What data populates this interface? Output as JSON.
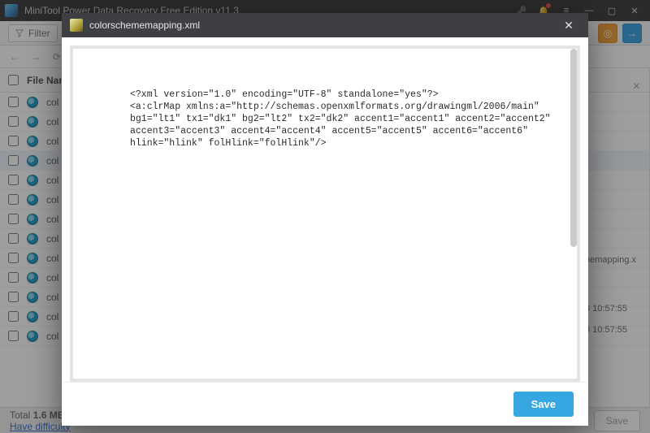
{
  "window": {
    "title": "MiniTool Power Data Recovery Free Edition v11.3"
  },
  "toolbar": {
    "filter_label": "Filter"
  },
  "list": {
    "header_name": "File Name",
    "rows": [
      "colorschememapping.xml",
      "colorschememapping.xml",
      "colorschememapping.xml",
      "colorschememapping.xml",
      "colorschememapping.xml",
      "colorschememapping.xml",
      "colorschememapping.xml",
      "colorschememapping.xml",
      "colorschememapping.xml",
      "colorschememapping.xml",
      "colorschememapping.xml",
      "colorschememapping.xml",
      "colorschememapping.xml"
    ],
    "selected_index": 3
  },
  "right_panel": {
    "filename_fragment": "nemapping.x",
    "time1": "3 10:57:55",
    "time2": "3 10:57:55"
  },
  "footer": {
    "total_prefix": "Total ",
    "total_bold": "1.6 MB",
    "total_suffix": " in",
    "difficulty_link": "Have difficulty",
    "save_label": "Save"
  },
  "modal": {
    "title": "colorschememapping.xml",
    "content": "<?xml version=\"1.0\" encoding=\"UTF-8\" standalone=\"yes\"?>\n<a:clrMap xmlns:a=\"http://schemas.openxmlformats.org/drawingml/2006/main\" bg1=\"lt1\" tx1=\"dk1\" bg2=\"lt2\" tx2=\"dk2\" accent1=\"accent1\" accent2=\"accent2\" accent3=\"accent3\" accent4=\"accent4\" accent5=\"accent5\" accent6=\"accent6\" hlink=\"hlink\" folHlink=\"folHlink\"/>",
    "save_label": "Save"
  }
}
